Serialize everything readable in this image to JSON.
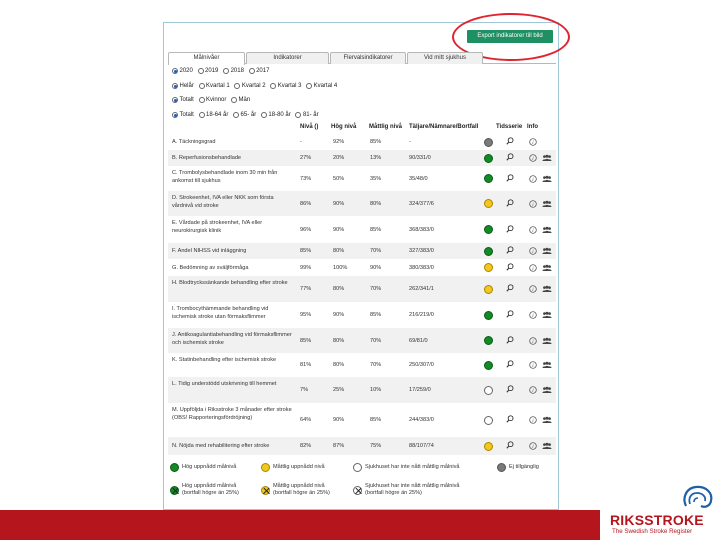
{
  "export_button": "Export indikatorer till bild",
  "tabs": [
    "Målnivåer",
    "Indikatorer",
    "Flervalsindikatorer",
    "Vid mitt sjukhus"
  ],
  "years": [
    "2020",
    "2019",
    "2018",
    "2017"
  ],
  "periods": [
    "Helår",
    "Kvartal 1",
    "Kvartal 2",
    "Kvartal 3",
    "Kvartal 4"
  ],
  "sexes": [
    "Totalt",
    "Kvinnor",
    "Män"
  ],
  "ages": [
    "Totalt",
    "18-64 år",
    "65- år",
    "18-80 år",
    "81- år"
  ],
  "columns": {
    "niva": "Nivå ()",
    "hog": "Hög nivå",
    "matt": "Måttlig nivå",
    "tal": "Täljare/Nämnare/Bortfall",
    "tid": "Tidsserie",
    "info": "Info"
  },
  "rows": [
    {
      "name": "A. Täckningsgrad",
      "niva": "-",
      "hog": "92%",
      "matt": "85%",
      "tal": "-",
      "status": "gray"
    },
    {
      "name": "B. Reperfusionsbehandlade",
      "niva": "27%",
      "hog": "20%",
      "matt": "13%",
      "tal": "90/331/0",
      "status": "green"
    },
    {
      "name": "C. Trombolysbehandlade inom 30 min från ankomst till sjukhus",
      "niva": "73%",
      "hog": "50%",
      "matt": "35%",
      "tal": "35/48/0",
      "status": "green"
    },
    {
      "name": "D. Strokeenhet, IVA eller NKK som första vårdnivå vid stroke",
      "niva": "86%",
      "hog": "90%",
      "matt": "80%",
      "tal": "324/377/6",
      "status": "yellow"
    },
    {
      "name": "E. Vårdade på strokeenhet, IVA eller neurokirurgisk klinik",
      "niva": "96%",
      "hog": "90%",
      "matt": "85%",
      "tal": "368/383/0",
      "status": "green"
    },
    {
      "name": "F. Andel NIHSS vid inläggning",
      "niva": "85%",
      "hog": "80%",
      "matt": "70%",
      "tal": "327/383/0",
      "status": "green"
    },
    {
      "name": "G. Bedömning av sväljförmåga",
      "niva": "99%",
      "hog": "100%",
      "matt": "90%",
      "tal": "380/383/0",
      "status": "yellow"
    },
    {
      "name": "H. Blodtryckssänkande behandling efter stroke",
      "niva": "77%",
      "hog": "80%",
      "matt": "70%",
      "tal": "262/341/1",
      "status": "yellow"
    },
    {
      "name": "I. Trombocythämmande behandling vid ischemisk stroke utan förmaksflimmer",
      "niva": "95%",
      "hog": "90%",
      "matt": "85%",
      "tal": "216/219/0",
      "status": "green"
    },
    {
      "name": "J. Antikoagulantiabehandling vid förmaksflimmer och ischemisk stroke",
      "niva": "85%",
      "hog": "80%",
      "matt": "70%",
      "tal": "69/81/0",
      "status": "green"
    },
    {
      "name": "K. Statinbehandling efter ischemisk stroke",
      "niva": "81%",
      "hog": "80%",
      "matt": "70%",
      "tal": "250/307/0",
      "status": "green"
    },
    {
      "name": "L. Tidig understödd utskrivning till hemmet",
      "niva": "7%",
      "hog": "25%",
      "matt": "10%",
      "tal": "17/259/0",
      "status": "empty"
    },
    {
      "name": "M. Uppföljda i Riksstroke 3 månader efter stroke (OBS! Rapporteringsfördröjning)",
      "niva": "64%",
      "hog": "90%",
      "matt": "85%",
      "tal": "244/383/0",
      "status": "empty"
    },
    {
      "name": "N. Nöjda med rehabilitering efter stroke",
      "niva": "82%",
      "hog": "87%",
      "matt": "75%",
      "tal": "88/107/74",
      "status": "yellow"
    }
  ],
  "legend": {
    "high": "Hög uppnådd målnivå",
    "moderate": "Måttlig uppnådd nivå",
    "none": "Sjukhuset har inte nått måttlig målnivå",
    "na": "Ej tillgänglig",
    "high_drop": "Hög uppnådd målnivå\n(bortfall högre än 25%)",
    "moderate_drop": "Måttlig uppnådd nivå\n(bortfall högre än 25%)",
    "none_drop": "Sjukhuset har inte nått måttlig målnivå\n(bortfall högre än 25%)"
  },
  "brand": {
    "name": "RIKSSTROKE",
    "tagline": "The Swedish Stroke Register"
  },
  "colors": {
    "green": "#128a25",
    "yellow": "#f3c81a",
    "gray": "#7a7a7a",
    "accent_red": "#b5161d",
    "export_green": "#1f8f64"
  }
}
